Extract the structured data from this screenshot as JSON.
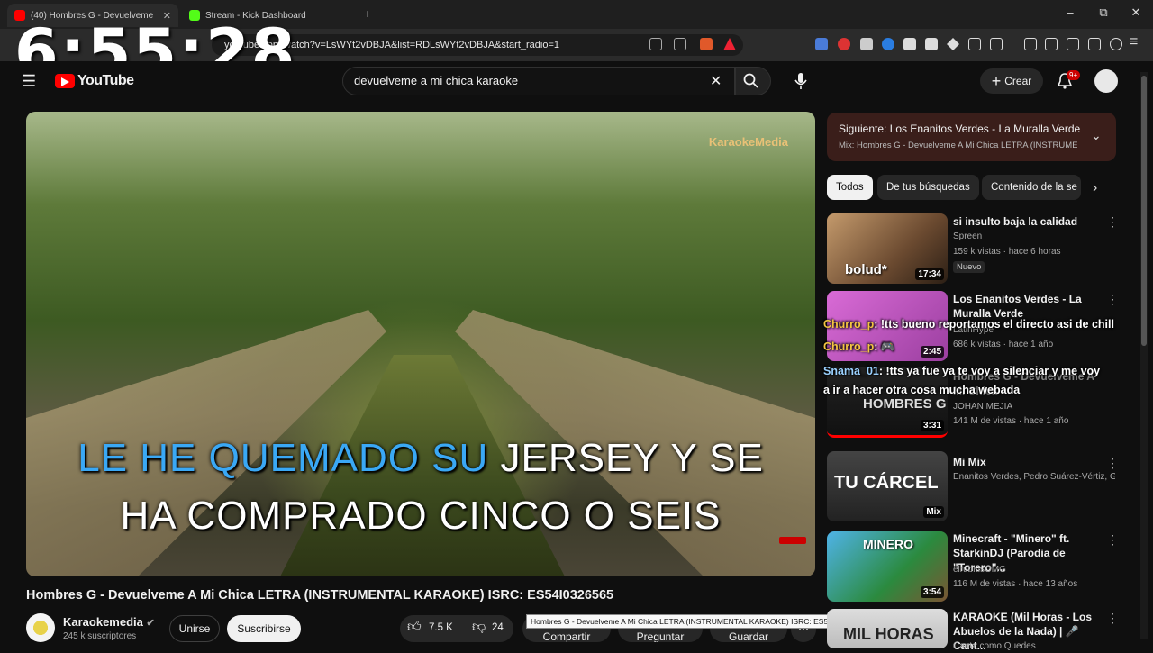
{
  "browser": {
    "tabs": [
      {
        "title": "(40) Hombres G - Devuelveme",
        "color": "#ff0000",
        "active": true
      },
      {
        "title": "Stream - Kick Dashboard",
        "color": "#53fc18",
        "active": false
      }
    ],
    "new_tab": "+",
    "url": "youtube.com/watch?v=LsWYt2vDBJA&list=RDLsWYt2vDBJA&start_radio=1",
    "window": {
      "minimize": "–",
      "maximize": "⧉",
      "close": "✕"
    }
  },
  "overlay": {
    "clock": "6:55:28"
  },
  "yt": {
    "logo": "YouTube",
    "search_query": "devuelveme a mi chica karaoke",
    "create_label": "Crear",
    "notif_badge": "9+"
  },
  "video": {
    "lyric_line1_highlight": "LE HE QUEMADO SU",
    "lyric_line1_rest": " JERSEY Y SE",
    "lyric_line2_highlight": "",
    "lyric_line2_rest": "HA COMPRADO CINCO O SEIS",
    "watermark": "KaraokeMedia",
    "title": "Hombres G - Devuelveme A Mi Chica LETRA (INSTRUMENTAL KARAOKE) ISRC: ES54I0326565",
    "channel": "Karaokemedia",
    "subscribers": "245 k suscriptores",
    "join_label": "Unirse",
    "subscribe_label": "Suscribirse",
    "likes": "7.5 K",
    "dislikes": "24",
    "share_label": "Compartir",
    "ask_label": "Preguntar",
    "save_label": "Guardar",
    "tooltip": "Hombres G - Devuelveme A Mi Chica LETRA (INSTRUMENTAL KARAOKE) ISRC: ES54I0326565"
  },
  "sidebar": {
    "next_title": "Siguiente: Los Enanitos Verdes - La Muralla Verde",
    "next_sub": "Mix: Hombres G - Devuelveme A Mi Chica LETRA (INSTRUMENTAL KARAOKE)",
    "chips": [
      "Todos",
      "De tus búsquedas",
      "Contenido de la se"
    ],
    "items": [
      {
        "title": "si insulto baja la calidad",
        "channel": "Spreen",
        "meta": "159 k vistas · hace 6 horas",
        "badge": "Nuevo",
        "duration": "17:34",
        "thumb_text": "bolud*"
      },
      {
        "title": "Los Enanitos Verdes - La Muralla Verde",
        "channel": "LatinHype",
        "meta": "686 k vistas · hace 1 año",
        "duration": "2:45"
      },
      {
        "title": "Hombres G - Devuelveme A Mi Chica",
        "channel": "JOHAN MEJIA",
        "meta": "141 M de vistas · hace 1 año",
        "duration": "3:31",
        "thumb_text": "HOMBRES G"
      },
      {
        "title": "Mi Mix",
        "channel": "Enanitos Verdes, Pedro Suárez-Vértiz, Gr...",
        "meta": "",
        "duration": "Mix",
        "thumb_text": "TU CÁRCEL"
      },
      {
        "title": "Minecraft - \"Minero\" ft. StarkinDJ (Parodia de \"Torero\"...",
        "channel": "elrubiusOMG",
        "meta": "116 M de vistas · hace 13 años",
        "duration": "3:54",
        "thumb_text": "MINERO"
      },
      {
        "title": "KARAOKE (Mil Horas - Los Abuelos de la Nada) | 🎤 Cant...",
        "channel": "Canta como Quedes",
        "meta": "",
        "duration": "",
        "thumb_text": "MIL HORAS"
      }
    ]
  },
  "chat": [
    {
      "user": "Churro_p",
      "text": ": !tts bueno reportamos el directo asi de chill"
    },
    {
      "user": "Churro_p",
      "text": ": 🎮"
    },
    {
      "user": "Snama_01",
      "text": ": !tts ya fue ya te voy a silenciar y me voy"
    },
    {
      "user": "",
      "text": "a ir a hacer otra cosa mucha webada"
    }
  ]
}
